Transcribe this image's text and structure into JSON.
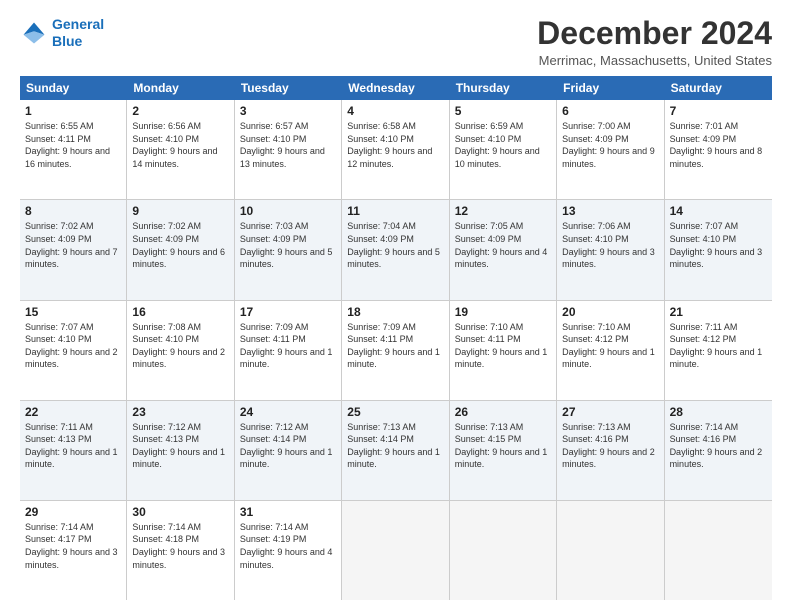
{
  "logo": {
    "line1": "General",
    "line2": "Blue"
  },
  "title": "December 2024",
  "location": "Merrimac, Massachusetts, United States",
  "header_days": [
    "Sunday",
    "Monday",
    "Tuesday",
    "Wednesday",
    "Thursday",
    "Friday",
    "Saturday"
  ],
  "weeks": [
    [
      {
        "day": "1",
        "info": "Sunrise: 6:55 AM\nSunset: 4:11 PM\nDaylight: 9 hours and 16 minutes.",
        "shaded": false
      },
      {
        "day": "2",
        "info": "Sunrise: 6:56 AM\nSunset: 4:10 PM\nDaylight: 9 hours and 14 minutes.",
        "shaded": false
      },
      {
        "day": "3",
        "info": "Sunrise: 6:57 AM\nSunset: 4:10 PM\nDaylight: 9 hours and 13 minutes.",
        "shaded": false
      },
      {
        "day": "4",
        "info": "Sunrise: 6:58 AM\nSunset: 4:10 PM\nDaylight: 9 hours and 12 minutes.",
        "shaded": false
      },
      {
        "day": "5",
        "info": "Sunrise: 6:59 AM\nSunset: 4:10 PM\nDaylight: 9 hours and 10 minutes.",
        "shaded": false
      },
      {
        "day": "6",
        "info": "Sunrise: 7:00 AM\nSunset: 4:09 PM\nDaylight: 9 hours and 9 minutes.",
        "shaded": false
      },
      {
        "day": "7",
        "info": "Sunrise: 7:01 AM\nSunset: 4:09 PM\nDaylight: 9 hours and 8 minutes.",
        "shaded": false
      }
    ],
    [
      {
        "day": "8",
        "info": "Sunrise: 7:02 AM\nSunset: 4:09 PM\nDaylight: 9 hours and 7 minutes.",
        "shaded": true
      },
      {
        "day": "9",
        "info": "Sunrise: 7:02 AM\nSunset: 4:09 PM\nDaylight: 9 hours and 6 minutes.",
        "shaded": true
      },
      {
        "day": "10",
        "info": "Sunrise: 7:03 AM\nSunset: 4:09 PM\nDaylight: 9 hours and 5 minutes.",
        "shaded": true
      },
      {
        "day": "11",
        "info": "Sunrise: 7:04 AM\nSunset: 4:09 PM\nDaylight: 9 hours and 5 minutes.",
        "shaded": true
      },
      {
        "day": "12",
        "info": "Sunrise: 7:05 AM\nSunset: 4:09 PM\nDaylight: 9 hours and 4 minutes.",
        "shaded": true
      },
      {
        "day": "13",
        "info": "Sunrise: 7:06 AM\nSunset: 4:10 PM\nDaylight: 9 hours and 3 minutes.",
        "shaded": true
      },
      {
        "day": "14",
        "info": "Sunrise: 7:07 AM\nSunset: 4:10 PM\nDaylight: 9 hours and 3 minutes.",
        "shaded": true
      }
    ],
    [
      {
        "day": "15",
        "info": "Sunrise: 7:07 AM\nSunset: 4:10 PM\nDaylight: 9 hours and 2 minutes.",
        "shaded": false
      },
      {
        "day": "16",
        "info": "Sunrise: 7:08 AM\nSunset: 4:10 PM\nDaylight: 9 hours and 2 minutes.",
        "shaded": false
      },
      {
        "day": "17",
        "info": "Sunrise: 7:09 AM\nSunset: 4:11 PM\nDaylight: 9 hours and 1 minute.",
        "shaded": false
      },
      {
        "day": "18",
        "info": "Sunrise: 7:09 AM\nSunset: 4:11 PM\nDaylight: 9 hours and 1 minute.",
        "shaded": false
      },
      {
        "day": "19",
        "info": "Sunrise: 7:10 AM\nSunset: 4:11 PM\nDaylight: 9 hours and 1 minute.",
        "shaded": false
      },
      {
        "day": "20",
        "info": "Sunrise: 7:10 AM\nSunset: 4:12 PM\nDaylight: 9 hours and 1 minute.",
        "shaded": false
      },
      {
        "day": "21",
        "info": "Sunrise: 7:11 AM\nSunset: 4:12 PM\nDaylight: 9 hours and 1 minute.",
        "shaded": false
      }
    ],
    [
      {
        "day": "22",
        "info": "Sunrise: 7:11 AM\nSunset: 4:13 PM\nDaylight: 9 hours and 1 minute.",
        "shaded": true
      },
      {
        "day": "23",
        "info": "Sunrise: 7:12 AM\nSunset: 4:13 PM\nDaylight: 9 hours and 1 minute.",
        "shaded": true
      },
      {
        "day": "24",
        "info": "Sunrise: 7:12 AM\nSunset: 4:14 PM\nDaylight: 9 hours and 1 minute.",
        "shaded": true
      },
      {
        "day": "25",
        "info": "Sunrise: 7:13 AM\nSunset: 4:14 PM\nDaylight: 9 hours and 1 minute.",
        "shaded": true
      },
      {
        "day": "26",
        "info": "Sunrise: 7:13 AM\nSunset: 4:15 PM\nDaylight: 9 hours and 1 minute.",
        "shaded": true
      },
      {
        "day": "27",
        "info": "Sunrise: 7:13 AM\nSunset: 4:16 PM\nDaylight: 9 hours and 2 minutes.",
        "shaded": true
      },
      {
        "day": "28",
        "info": "Sunrise: 7:14 AM\nSunset: 4:16 PM\nDaylight: 9 hours and 2 minutes.",
        "shaded": true
      }
    ],
    [
      {
        "day": "29",
        "info": "Sunrise: 7:14 AM\nSunset: 4:17 PM\nDaylight: 9 hours and 3 minutes.",
        "shaded": false
      },
      {
        "day": "30",
        "info": "Sunrise: 7:14 AM\nSunset: 4:18 PM\nDaylight: 9 hours and 3 minutes.",
        "shaded": false
      },
      {
        "day": "31",
        "info": "Sunrise: 7:14 AM\nSunset: 4:19 PM\nDaylight: 9 hours and 4 minutes.",
        "shaded": false
      },
      {
        "day": "",
        "info": "",
        "shaded": false,
        "empty": true
      },
      {
        "day": "",
        "info": "",
        "shaded": false,
        "empty": true
      },
      {
        "day": "",
        "info": "",
        "shaded": false,
        "empty": true
      },
      {
        "day": "",
        "info": "",
        "shaded": false,
        "empty": true
      }
    ]
  ]
}
